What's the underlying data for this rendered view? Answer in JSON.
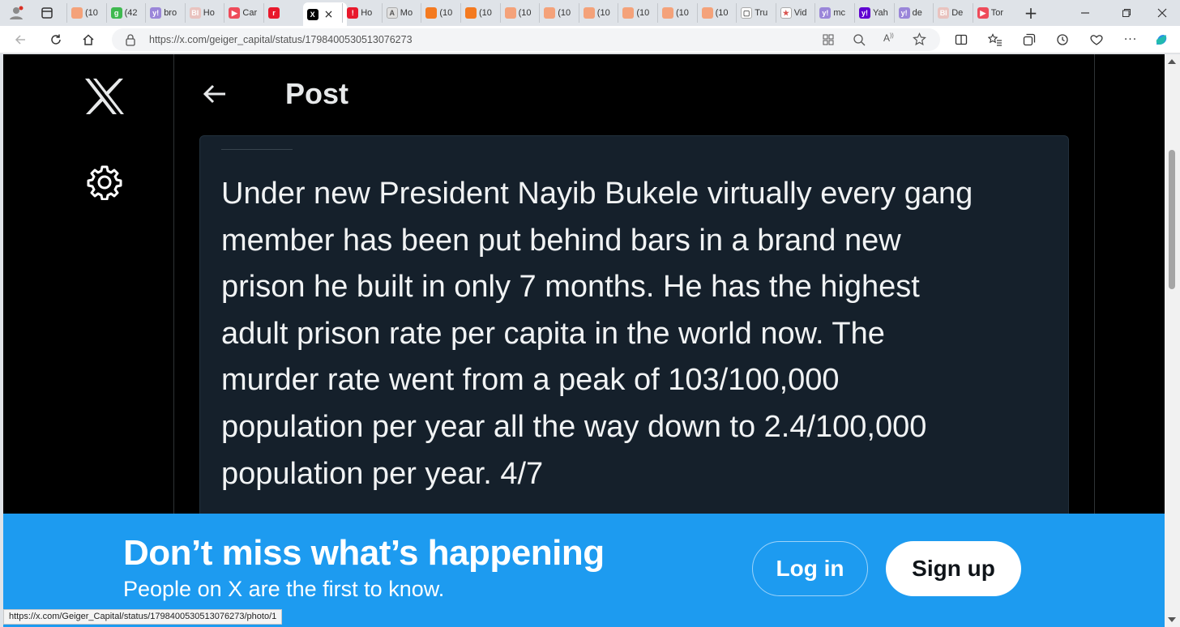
{
  "browser": {
    "tabs": [
      {
        "title": "(10",
        "fav_color": "#f4a27a",
        "fav_char": ""
      },
      {
        "title": "(42",
        "fav_color": "#3fb950",
        "fav_char": "g"
      },
      {
        "title": "bro",
        "fav_color": "#9a86d9",
        "fav_char": "y!"
      },
      {
        "title": "Ho",
        "fav_color": "#e9c3bf",
        "fav_char": "BI"
      },
      {
        "title": "Car",
        "fav_color": "#ee4b5a",
        "fav_char": "▶"
      },
      {
        "title": "",
        "fav_color": "#e8192c",
        "fav_char": "r"
      },
      {
        "title": "",
        "fav_color": "#000000",
        "fav_char": "X"
      },
      {
        "title": "Ho",
        "fav_color": "#e8192c",
        "fav_char": "!"
      },
      {
        "title": "Mo",
        "fav_color": "#e0e0e0",
        "fav_char": "A"
      },
      {
        "title": "(10",
        "fav_color": "#f47a20",
        "fav_char": ""
      },
      {
        "title": "(10",
        "fav_color": "#f47a20",
        "fav_char": ""
      },
      {
        "title": "(10",
        "fav_color": "#f4a27a",
        "fav_char": ""
      },
      {
        "title": "(10",
        "fav_color": "#f4a27a",
        "fav_char": ""
      },
      {
        "title": "(10",
        "fav_color": "#f4a27a",
        "fav_char": ""
      },
      {
        "title": "(10",
        "fav_color": "#f4a27a",
        "fav_char": ""
      },
      {
        "title": "(10",
        "fav_color": "#f4a27a",
        "fav_char": ""
      },
      {
        "title": "(10",
        "fav_color": "#f4a27a",
        "fav_char": ""
      },
      {
        "title": "Tru",
        "fav_color": "#ffffff",
        "fav_char": "▢"
      },
      {
        "title": "Vid",
        "fav_color": "#ffffff",
        "fav_char": "★"
      },
      {
        "title": "mc",
        "fav_color": "#9a86d9",
        "fav_char": "y!"
      },
      {
        "title": "Yah",
        "fav_color": "#5f01d1",
        "fav_char": "y!"
      },
      {
        "title": "de",
        "fav_color": "#9a86d9",
        "fav_char": "y!"
      },
      {
        "title": "De",
        "fav_color": "#e9c3bf",
        "fav_char": "BI"
      },
      {
        "title": "Tor",
        "fav_color": "#ee4b5a",
        "fav_char": "▶"
      }
    ],
    "active_tab_close": "×",
    "new_tab": "+",
    "url": "https://x.com/geiger_capital/status/1798400530513076273",
    "status_url": "https://x.com/Geiger_Capital/status/1798400530513076273/photo/1"
  },
  "page": {
    "title": "Post",
    "tweet_lines": [
      "Under new President Nayib Bukele virtually every gang",
      "member has been put behind bars in a brand new",
      "prison he built in only 7 months. He has the highest",
      "adult prison rate per capita in the world now. The",
      "murder rate went from a peak of 103/100,000",
      "population per year all the way down to 2.4/100,000",
      "population per year. 4/7"
    ]
  },
  "banner": {
    "heading": "Don’t miss what’s happening",
    "subheading": "People on X are the first to know.",
    "login_label": "Log in",
    "signup_label": "Sign up"
  },
  "colors": {
    "banner": "#1d9bf0",
    "card": "#15202b",
    "page_bg": "#000000"
  }
}
